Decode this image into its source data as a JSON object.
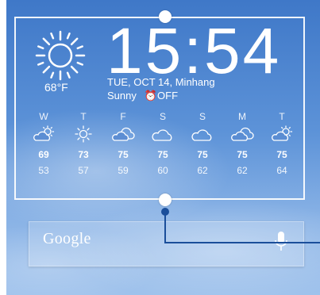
{
  "current": {
    "temperature": "68°F",
    "icon": "sun-icon",
    "time": "15:54",
    "date_location": "TUE, OCT 14, Minhang",
    "condition": "Sunny",
    "alarm_status": "⏰OFF"
  },
  "forecast": [
    {
      "day": "W",
      "icon": "partly-cloudy-icon",
      "high": "69",
      "low": "53"
    },
    {
      "day": "T",
      "icon": "sun-icon",
      "high": "73",
      "low": "57"
    },
    {
      "day": "F",
      "icon": "cloudy-icon",
      "high": "75",
      "low": "59"
    },
    {
      "day": "S",
      "icon": "cloud-icon",
      "high": "75",
      "low": "60"
    },
    {
      "day": "S",
      "icon": "cloud-icon",
      "high": "75",
      "low": "62"
    },
    {
      "day": "M",
      "icon": "cloudy-icon",
      "high": "75",
      "low": "62"
    },
    {
      "day": "T",
      "icon": "partly-cloudy-icon",
      "high": "75",
      "low": "64"
    }
  ],
  "search": {
    "logo_text": "Google",
    "mic_icon": "microphone-icon"
  },
  "colors": {
    "accent_line": "#1a4e9a",
    "sky_top": "#3f78c8",
    "sky_bottom": "#9fc2ec"
  }
}
